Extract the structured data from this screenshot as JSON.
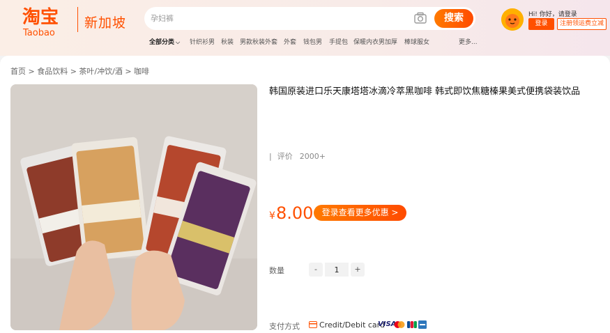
{
  "header": {
    "logo_cn": "淘宝",
    "logo_en": "Taobao",
    "region": "新加坡",
    "search": {
      "placeholder": "孕妇裤",
      "button": "搜索"
    },
    "nav": [
      "全部分类",
      "针织衫男",
      "秋装",
      "男款秋装外套",
      "外套",
      "钱包男",
      "手提包",
      "保暖内衣男加厚",
      "棒球服女",
      "更多..."
    ],
    "user": {
      "greeting": "Hi! 你好，请登录",
      "login": "登录",
      "register": "注册领运费立减"
    }
  },
  "breadcrumb": "首页 > 食品饮料 > 茶叶/冲饮/酒 > 咖啡",
  "product": {
    "title": "韩国原装进口乐天康塔塔冰滴冷萃黑咖啡 韩式即饮焦糖榛果美式便携袋装饮品",
    "rating_label": "评价",
    "rating_count": "2000+",
    "price_symbol": "¥",
    "price": "8.00",
    "promo_button": "登录查看更多优惠 >",
    "quantity_label": "数量",
    "quantity_minus": "-",
    "quantity_value": "1",
    "quantity_plus": "+",
    "payment_label": "支付方式",
    "payment_method": "Credit/Debit card",
    "payment_brand": "VISA"
  },
  "colors": {
    "accent": "#ff5000",
    "header_bg": "#fbeee6"
  }
}
